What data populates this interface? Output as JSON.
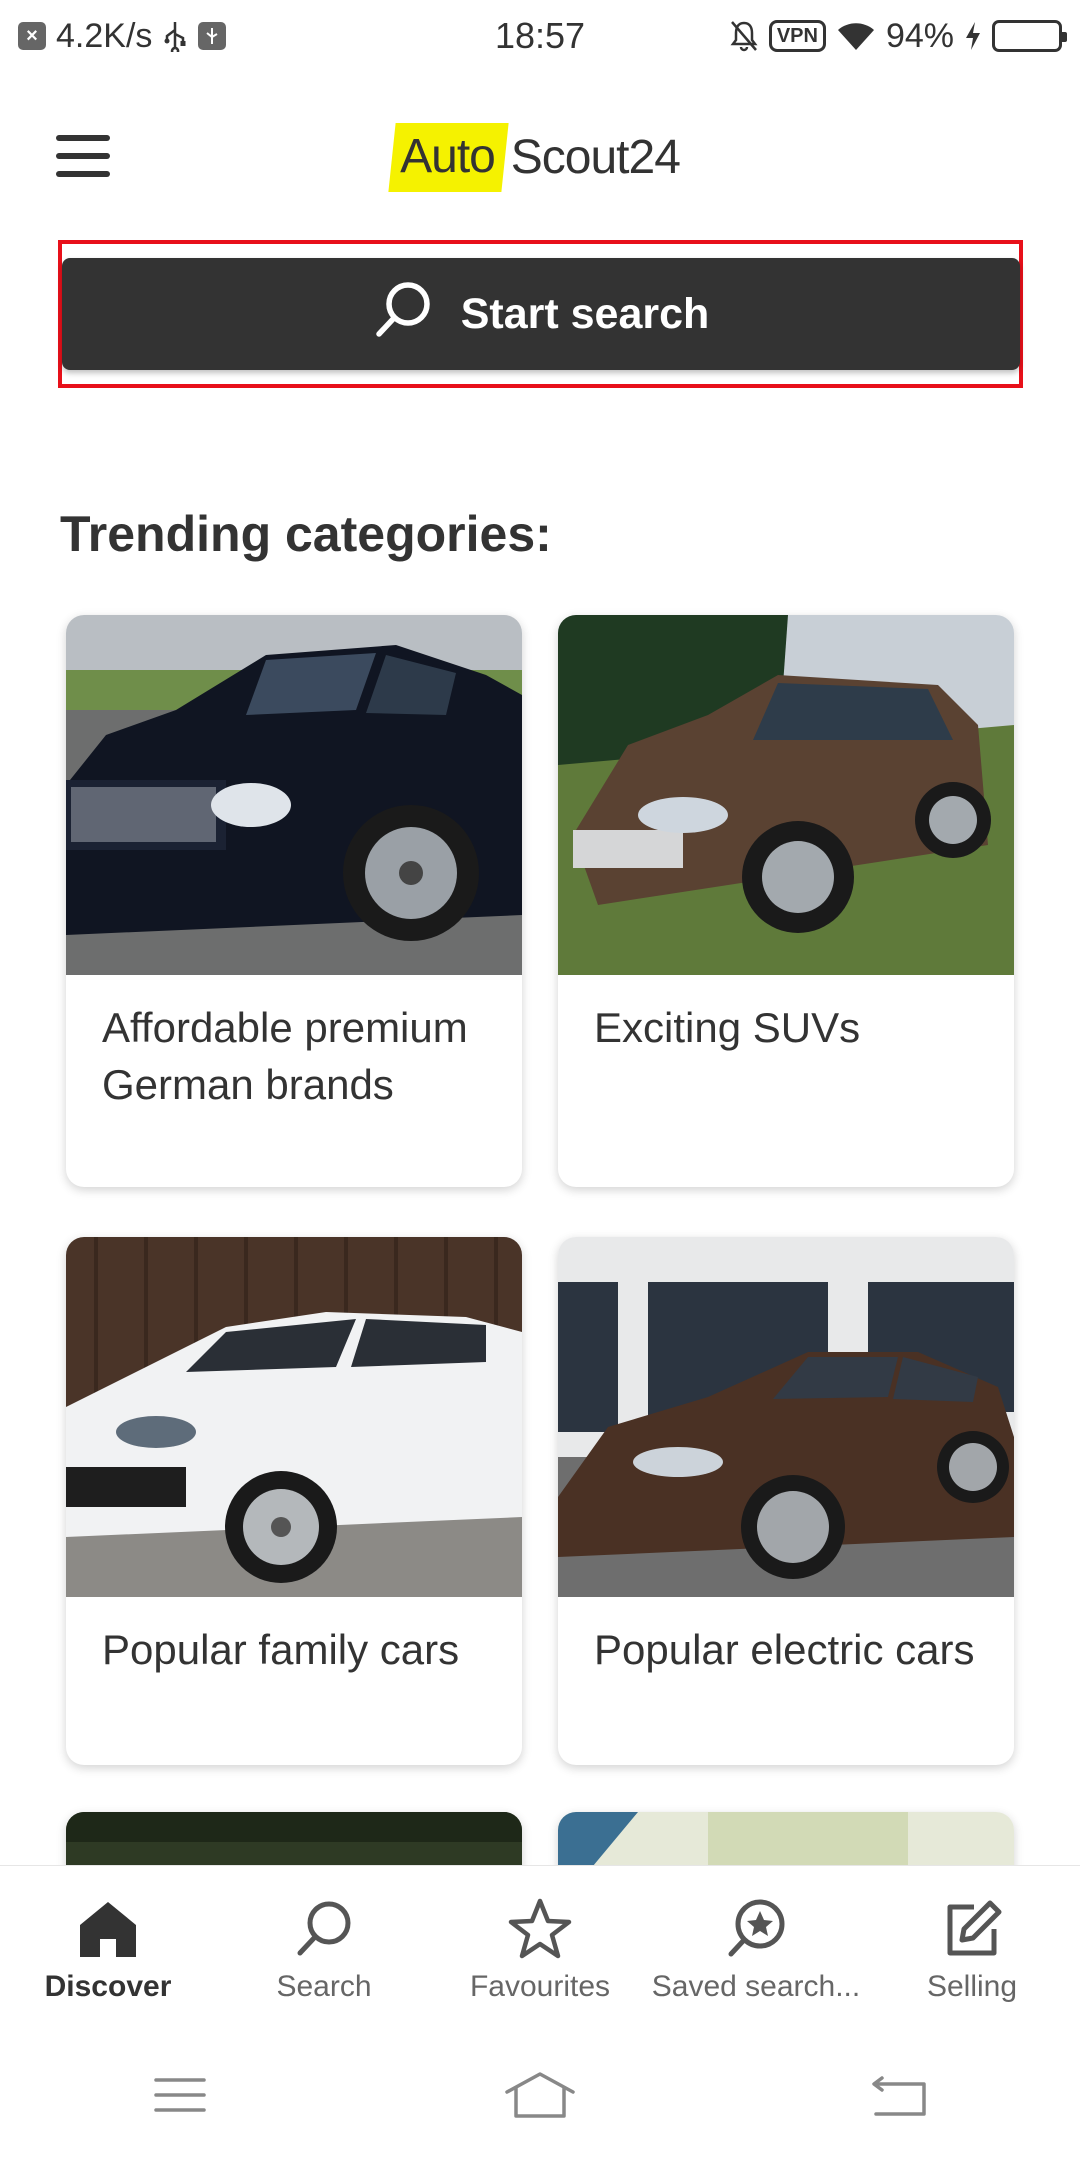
{
  "status_bar": {
    "net_speed": "4.2K/s",
    "time": "18:57",
    "vpn_label": "VPN",
    "battery_percent": "94%",
    "battery_level": 0.94
  },
  "header": {
    "logo_part1": "Auto",
    "logo_part2": "Scout24",
    "logo_accent": "#f5f200"
  },
  "search": {
    "label": "Start search"
  },
  "trending": {
    "title": "Trending categories:",
    "cards": [
      {
        "label": "Affordable premium German brands"
      },
      {
        "label": "Exciting SUVs"
      },
      {
        "label": "Popular family cars"
      },
      {
        "label": "Popular electric cars"
      }
    ]
  },
  "bottom_nav": {
    "items": [
      {
        "label": "Discover",
        "icon": "home-icon",
        "active": true
      },
      {
        "label": "Search",
        "icon": "search-icon"
      },
      {
        "label": "Favourites",
        "icon": "star-icon"
      },
      {
        "label": "Saved search...",
        "icon": "saved-search-icon"
      },
      {
        "label": "Selling",
        "icon": "edit-icon"
      }
    ]
  },
  "colors": {
    "primary_dark": "#333333",
    "highlight_border": "#e8101a"
  }
}
